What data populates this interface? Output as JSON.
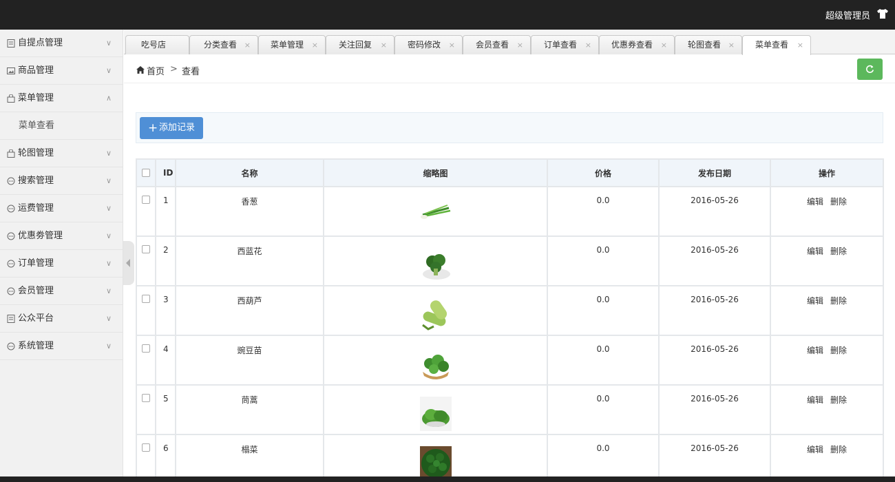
{
  "header": {
    "user": "超级管理员"
  },
  "sidebar": {
    "items": [
      {
        "label": "自提点管理",
        "chev": "∨"
      },
      {
        "label": "商品管理",
        "chev": "∨"
      },
      {
        "label": "菜单管理",
        "chev": "∧"
      },
      {
        "label": "菜单查看"
      },
      {
        "label": "轮图管理",
        "chev": "∨"
      },
      {
        "label": "搜索管理",
        "chev": "∨"
      },
      {
        "label": "运费管理",
        "chev": "∨"
      },
      {
        "label": "优惠劵管理",
        "chev": "∨"
      },
      {
        "label": "订单管理",
        "chev": "∨"
      },
      {
        "label": "会员管理",
        "chev": "∨"
      },
      {
        "label": "公众平台",
        "chev": "∨"
      },
      {
        "label": "系统管理",
        "chev": "∨"
      }
    ]
  },
  "tabs": [
    {
      "label": "吃号店",
      "close": ""
    },
    {
      "label": "分类查看",
      "close": "×"
    },
    {
      "label": "菜单管理",
      "close": "×"
    },
    {
      "label": "关注回复",
      "close": "×"
    },
    {
      "label": "密码修改",
      "close": "×"
    },
    {
      "label": "会员查看",
      "close": "×"
    },
    {
      "label": "订单查看",
      "close": "×"
    },
    {
      "label": "优惠券查看",
      "close": "×"
    },
    {
      "label": "轮图查看",
      "close": "×"
    },
    {
      "label": "菜单查看",
      "close": "×"
    }
  ],
  "breadcrumb": {
    "home": "首页",
    "sep": ">",
    "current": "查看"
  },
  "toolbar": {
    "add_label": "添加记录",
    "add_icon": "+"
  },
  "table": {
    "headers": [
      "ID",
      "名称",
      "缩略图",
      "价格",
      "发布日期",
      "操作"
    ],
    "rows": [
      {
        "id": "1",
        "name": "香葱",
        "price": "0.0",
        "date": "2016-05-26",
        "edit": "编辑",
        "delete": "删除"
      },
      {
        "id": "2",
        "name": "西蓝花",
        "price": "0.0",
        "date": "2016-05-26",
        "edit": "编辑",
        "delete": "删除"
      },
      {
        "id": "3",
        "name": "西葫芦",
        "price": "0.0",
        "date": "2016-05-26",
        "edit": "编辑",
        "delete": "删除"
      },
      {
        "id": "4",
        "name": "豌豆苗",
        "price": "0.0",
        "date": "2016-05-26",
        "edit": "编辑",
        "delete": "删除"
      },
      {
        "id": "5",
        "name": "茼蒿",
        "price": "0.0",
        "date": "2016-05-26",
        "edit": "编辑",
        "delete": "删除"
      },
      {
        "id": "6",
        "name": "榻菜",
        "price": "0.0",
        "date": "2016-05-26",
        "edit": "编辑",
        "delete": "删除"
      }
    ]
  },
  "colors": {
    "topbar": "#222222",
    "add_button": "#4f8fd6",
    "refresh_button": "#5cb85c"
  }
}
